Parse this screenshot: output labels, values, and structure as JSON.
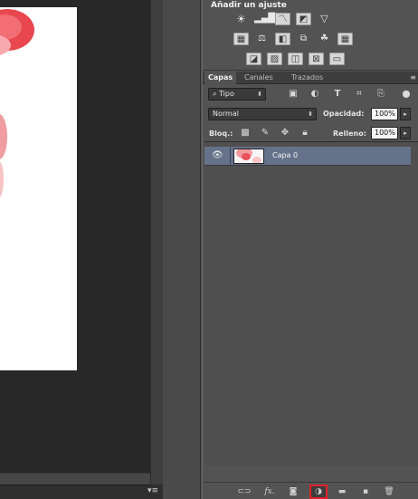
{
  "adjustments": {
    "title": "Añadir un ajuste",
    "row1": [
      "sun-icon",
      "histogram-icon",
      "curves-icon",
      "exposure-icon",
      "triangle-icon"
    ],
    "row2": [
      "vibrance-icon",
      "balance-icon",
      "bw-icon",
      "photo-filter-icon",
      "channel-mixer-icon",
      "grid-icon"
    ],
    "row3": [
      "invert-icon",
      "posterize-icon",
      "threshold-icon",
      "selective-color-icon",
      "gradient-map-icon"
    ]
  },
  "layers": {
    "tabs": [
      "Capas",
      "Canales",
      "Trazados"
    ],
    "active_tab": "Capas",
    "menu_icon": "≡",
    "filter_value": "Tipo",
    "blend_mode": "Normal",
    "opacity_label": "Opacidad:",
    "opacity_value": "100%",
    "lock_label": "Bloq.:",
    "fill_label": "Relleno:",
    "fill_value": "100%",
    "items": [
      {
        "name": "Capa 0",
        "visible": true,
        "selected": true
      }
    ]
  },
  "colors": {
    "panel_bg": "#535353",
    "canvas_bg": "#282828",
    "selected_layer": "#66728a",
    "highlight_box": "#e0202a"
  }
}
